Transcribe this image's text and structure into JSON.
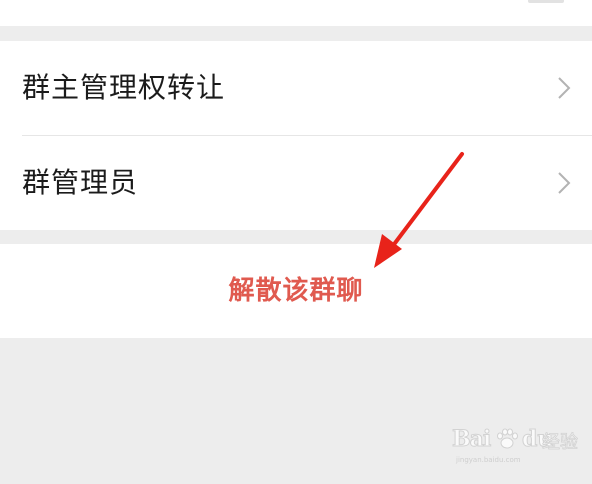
{
  "settings": {
    "items": [
      {
        "label": "群主管理权转让",
        "icon": "chevron-right-icon"
      },
      {
        "label": "群管理员",
        "icon": "chevron-right-icon"
      }
    ]
  },
  "actions": {
    "dissolve_label": "解散该群聊",
    "dissolve_color": "#e05a4f"
  },
  "annotation": {
    "arrow_color": "#e8231a"
  },
  "watermark": {
    "brand_left": "Bai",
    "brand_right": "du",
    "brand_cn": "经验",
    "url": "jingyan.baidu.com"
  },
  "colors": {
    "background": "#ededed",
    "card": "#ffffff",
    "text": "#1b1b1b",
    "chevron": "#b3b3b3"
  }
}
